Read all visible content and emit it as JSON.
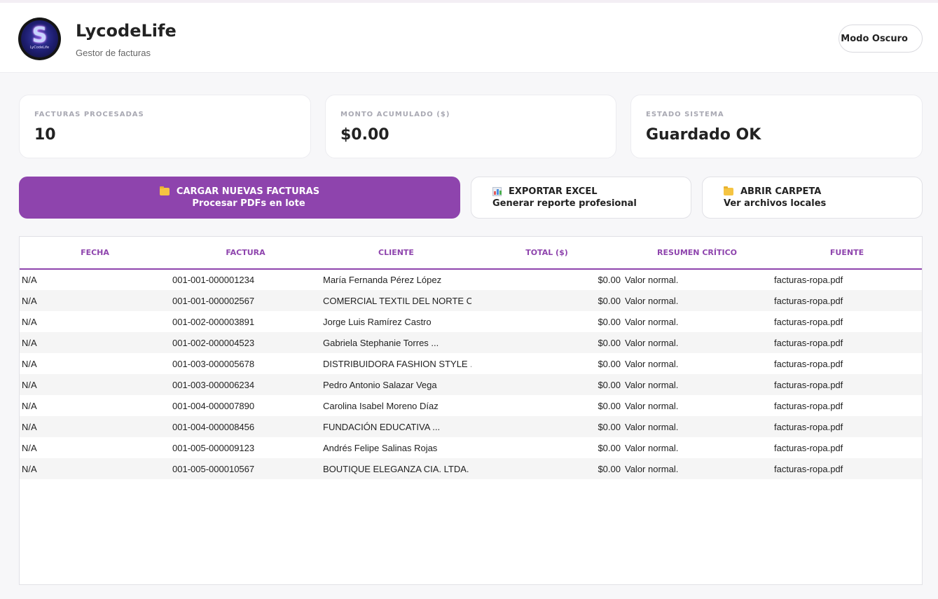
{
  "app": {
    "title": "LycodeLife",
    "subtitle": "Gestor de facturas",
    "logo_letter": "S",
    "logo_text": "LyCodeLife"
  },
  "header": {
    "dark_mode_label": "Modo Oscuro"
  },
  "stats": [
    {
      "label": "FACTURAS PROCESADAS",
      "value": "10"
    },
    {
      "label": "MONTO ACUMULADO ($)",
      "value": "$0.00"
    },
    {
      "label": "ESTADO SISTEMA",
      "value": "Guardado OK"
    }
  ],
  "actions": {
    "upload": {
      "title": "CARGAR NUEVAS FACTURAS",
      "subtitle": "Procesar PDFs en lote",
      "icon": "folder-icon"
    },
    "export": {
      "title": "EXPORTAR EXCEL",
      "subtitle": "Generar reporte profesional",
      "icon": "chart-icon"
    },
    "open": {
      "title": "ABRIR CARPETA",
      "subtitle": "Ver archivos locales",
      "icon": "folder-icon"
    }
  },
  "colors": {
    "accent": "#8e44ad",
    "folder": "#f5c442"
  },
  "table": {
    "columns": [
      "FECHA",
      "FACTURA",
      "CLIENTE",
      "TOTAL ($)",
      "RESUMEN CRÍTICO",
      "FUENTE"
    ],
    "rows": [
      {
        "fecha": "N/A",
        "factura": "001-001-000001234",
        "cliente": "María Fernanda Pérez López",
        "total": "$0.00",
        "resumen": "Valor normal.",
        "fuente": "facturas-ropa.pdf"
      },
      {
        "fecha": "N/A",
        "factura": "001-001-000002567",
        "cliente": "COMERCIAL TEXTIL DEL NORTE CI...",
        "total": "$0.00",
        "resumen": "Valor normal.",
        "fuente": "facturas-ropa.pdf"
      },
      {
        "fecha": "N/A",
        "factura": "001-002-000003891",
        "cliente": "Jorge Luis Ramírez Castro",
        "total": "$0.00",
        "resumen": "Valor normal.",
        "fuente": "facturas-ropa.pdf"
      },
      {
        "fecha": "N/A",
        "factura": "001-002-000004523",
        "cliente": "Gabriela Stephanie Torres ...",
        "total": "$0.00",
        "resumen": "Valor normal.",
        "fuente": "facturas-ropa.pdf"
      },
      {
        "fecha": "N/A",
        "factura": "001-003-000005678",
        "cliente": "DISTRIBUIDORA FASHION STYLE ...",
        "total": "$0.00",
        "resumen": "Valor normal.",
        "fuente": "facturas-ropa.pdf"
      },
      {
        "fecha": "N/A",
        "factura": "001-003-000006234",
        "cliente": "Pedro Antonio Salazar Vega",
        "total": "$0.00",
        "resumen": "Valor normal.",
        "fuente": "facturas-ropa.pdf"
      },
      {
        "fecha": "N/A",
        "factura": "001-004-000007890",
        "cliente": "Carolina Isabel Moreno Díaz",
        "total": "$0.00",
        "resumen": "Valor normal.",
        "fuente": "facturas-ropa.pdf"
      },
      {
        "fecha": "N/A",
        "factura": "001-004-000008456",
        "cliente": "FUNDACIÓN EDUCATIVA ...",
        "total": "$0.00",
        "resumen": "Valor normal.",
        "fuente": "facturas-ropa.pdf"
      },
      {
        "fecha": "N/A",
        "factura": "001-005-000009123",
        "cliente": "Andrés Felipe Salinas Rojas",
        "total": "$0.00",
        "resumen": "Valor normal.",
        "fuente": "facturas-ropa.pdf"
      },
      {
        "fecha": "N/A",
        "factura": "001-005-000010567",
        "cliente": "BOUTIQUE ELEGANZA CIA. LTDA.",
        "total": "$0.00",
        "resumen": "Valor normal.",
        "fuente": "facturas-ropa.pdf"
      }
    ]
  }
}
